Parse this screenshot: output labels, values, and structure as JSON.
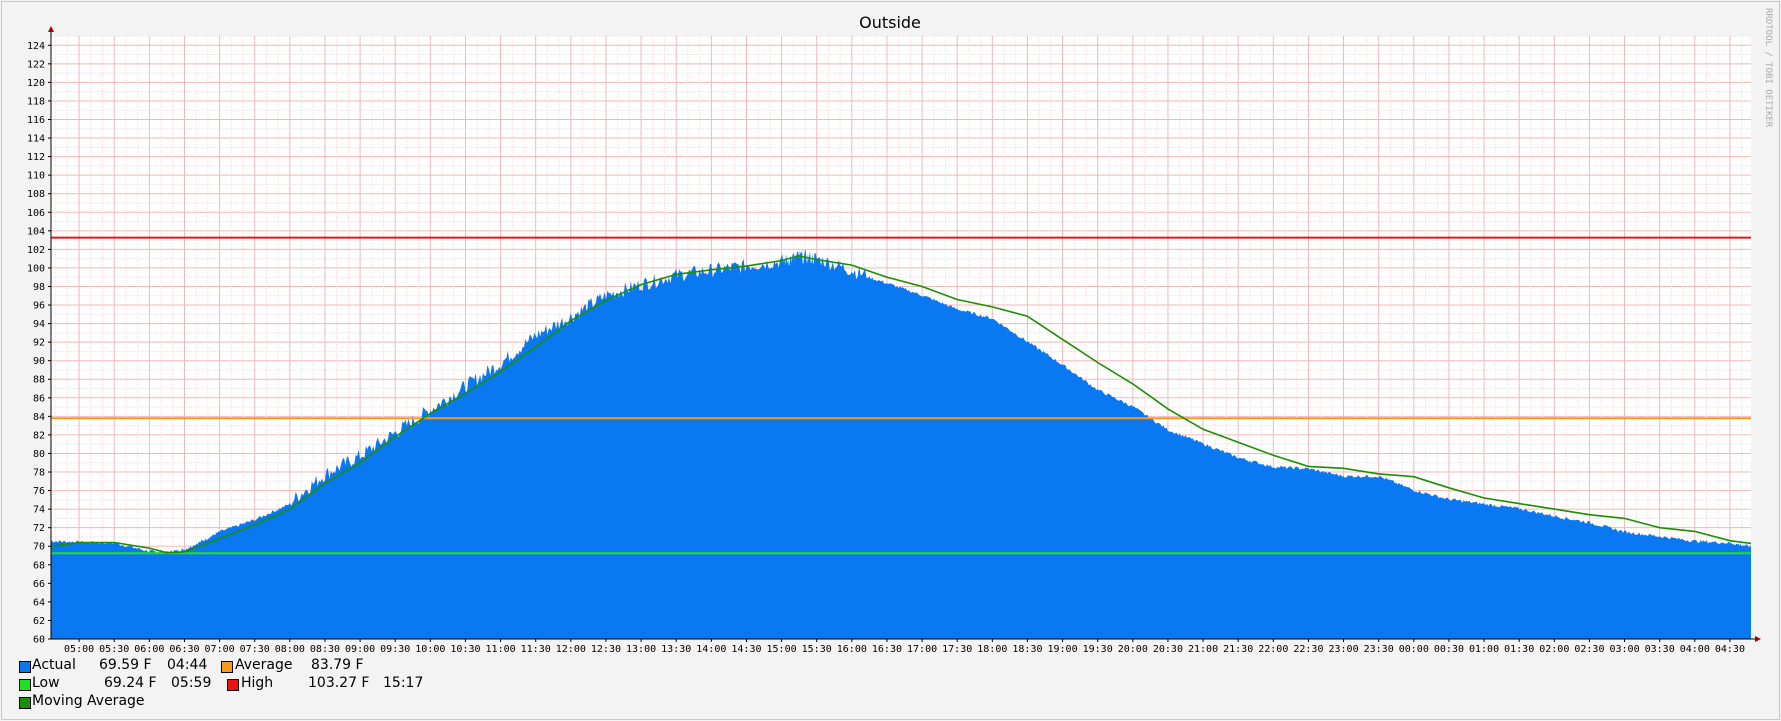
{
  "chart_data": {
    "type": "area",
    "title": "Outside",
    "watermark": "RRDTOOL / TOBI OETIKER",
    "ylim": [
      60,
      125
    ],
    "y_ticks": [
      60,
      62,
      64,
      66,
      68,
      70,
      72,
      74,
      76,
      78,
      80,
      82,
      84,
      86,
      88,
      90,
      92,
      94,
      96,
      98,
      100,
      102,
      104,
      106,
      108,
      110,
      112,
      114,
      116,
      118,
      120,
      122,
      124
    ],
    "x_ticks": [
      "05:00",
      "05:30",
      "06:00",
      "06:30",
      "07:00",
      "07:30",
      "08:00",
      "08:30",
      "09:00",
      "09:30",
      "10:00",
      "10:30",
      "11:00",
      "11:30",
      "12:00",
      "12:30",
      "13:00",
      "13:30",
      "14:00",
      "14:30",
      "15:00",
      "15:30",
      "16:00",
      "16:30",
      "17:00",
      "17:30",
      "18:00",
      "18:30",
      "19:00",
      "19:30",
      "20:00",
      "20:30",
      "21:00",
      "21:30",
      "22:00",
      "22:30",
      "23:00",
      "23:30",
      "00:00",
      "00:30",
      "01:00",
      "01:30",
      "02:00",
      "02:30",
      "03:00",
      "03:30",
      "04:00",
      "04:30"
    ],
    "x_hours": [
      4.6,
      28.8
    ],
    "series": [
      {
        "name": "Actual",
        "color": "#0a78f0",
        "x_hours": [
          4.6,
          5.0,
          5.5,
          6.0,
          6.25,
          6.5,
          6.75,
          7.0,
          7.5,
          8.0,
          8.5,
          9.0,
          9.5,
          10.0,
          10.5,
          11.0,
          11.5,
          12.0,
          12.5,
          13.0,
          13.5,
          14.0,
          14.5,
          15.0,
          15.25,
          15.5,
          16.0,
          16.5,
          17.0,
          17.5,
          18.0,
          18.5,
          19.0,
          19.5,
          20.0,
          20.5,
          21.0,
          21.5,
          22.0,
          22.5,
          23.0,
          23.5,
          24.0,
          24.5,
          25.0,
          25.5,
          26.0,
          26.5,
          27.0,
          27.5,
          28.0,
          28.5,
          28.8
        ],
        "values": [
          70.5,
          70.4,
          70.3,
          69.4,
          69.3,
          69.6,
          70.5,
          71.5,
          72.8,
          74.5,
          77.5,
          79.5,
          82.0,
          84.5,
          87.0,
          89.5,
          92.5,
          94.5,
          96.8,
          98.0,
          99.0,
          99.5,
          100.0,
          100.5,
          101.0,
          100.8,
          99.5,
          98.3,
          97.0,
          95.5,
          94.5,
          92.0,
          89.5,
          86.8,
          85.0,
          82.5,
          81.0,
          79.5,
          78.5,
          78.3,
          77.5,
          77.5,
          76.0,
          75.0,
          74.5,
          74.0,
          73.2,
          72.5,
          71.5,
          71.0,
          70.5,
          70.3,
          69.9
        ]
      },
      {
        "name": "Moving Average",
        "color": "#1a8f00",
        "x_hours": [
          4.6,
          5.0,
          5.5,
          6.0,
          6.25,
          6.5,
          7.0,
          7.5,
          8.0,
          8.5,
          9.0,
          9.5,
          10.0,
          10.5,
          11.0,
          11.5,
          12.0,
          12.5,
          13.0,
          13.5,
          14.0,
          14.5,
          15.0,
          15.25,
          15.5,
          16.0,
          16.5,
          17.0,
          17.5,
          18.0,
          18.5,
          19.0,
          19.5,
          20.0,
          20.5,
          21.0,
          21.5,
          22.0,
          22.5,
          23.0,
          23.5,
          24.0,
          24.5,
          25.0,
          25.5,
          26.0,
          26.5,
          27.0,
          27.5,
          28.0,
          28.5,
          28.8
        ],
        "values": [
          70.0,
          70.4,
          70.4,
          69.8,
          69.3,
          69.4,
          70.8,
          72.3,
          74.0,
          76.8,
          79.0,
          81.8,
          84.3,
          86.5,
          88.8,
          91.5,
          94.3,
          96.5,
          98.2,
          99.3,
          99.8,
          100.2,
          100.8,
          101.3,
          100.9,
          100.3,
          99.0,
          98.0,
          96.6,
          95.8,
          94.8,
          92.3,
          89.8,
          87.5,
          84.8,
          82.6,
          81.2,
          79.8,
          78.6,
          78.4,
          77.8,
          77.5,
          76.3,
          75.2,
          74.6,
          74.0,
          73.4,
          73.0,
          72.0,
          71.6,
          70.6,
          70.3
        ]
      },
      {
        "name": "Average",
        "color": "#f59a1e",
        "value": 83.79
      },
      {
        "name": "Low",
        "color": "#22dd22",
        "value": 69.24
      },
      {
        "name": "High",
        "color": "#ee1111",
        "value": 103.27
      }
    ],
    "grid": true,
    "legend_position": "bottom-left"
  },
  "legend": {
    "actual": {
      "label": "Actual",
      "value": "69.59 F",
      "time": "04:44",
      "color": "#0a78f0"
    },
    "average": {
      "label": "Average",
      "value": "83.79 F",
      "color": "#f59a1e"
    },
    "low": {
      "label": "Low",
      "value": "69.24 F",
      "time": "05:59",
      "color": "#22dd22"
    },
    "high": {
      "label": "High",
      "value": "103.27 F",
      "time": "15:17",
      "color": "#ee1111"
    },
    "moving_average": {
      "label": "Moving Average",
      "color": "#1a8f00"
    }
  }
}
